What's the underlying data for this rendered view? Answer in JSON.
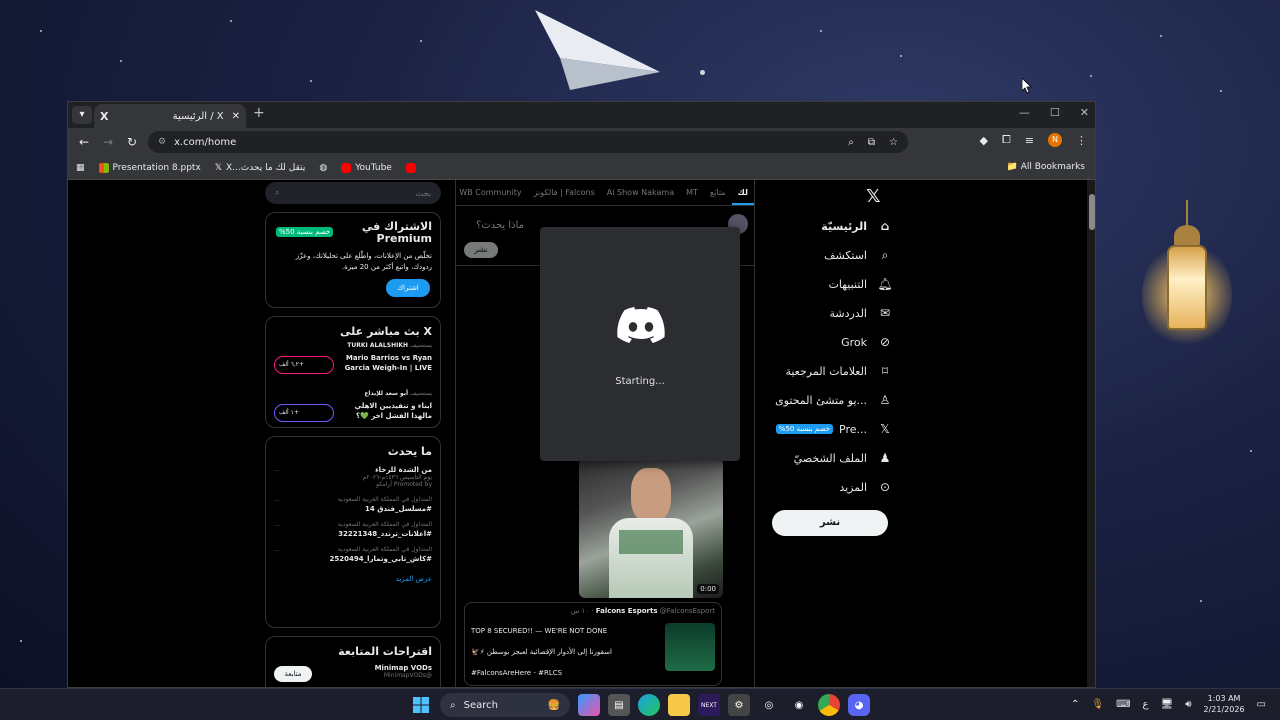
{
  "browser": {
    "tab_title": "الرئيسية / X",
    "tab_logo": "X",
    "url": "x.com/home",
    "bookmarks": [
      {
        "label": "Presentation 8.pptx",
        "icon": "windows-icon",
        "color": "#f25022"
      },
      {
        "label": "X...يتقل لك ما يحدث",
        "icon": "x-icon",
        "color": "#ffffff"
      },
      {
        "label": "",
        "icon": "globe-icon",
        "color": "#cccccc"
      },
      {
        "label": "YouTube",
        "icon": "youtube-icon",
        "color": "#ff0000"
      },
      {
        "label": "",
        "icon": "youtube-icon",
        "color": "#ff0000"
      }
    ],
    "all_bookmarks": "All Bookmarks",
    "profile_initial": "N"
  },
  "nav": {
    "brand": "𝕏",
    "items": [
      {
        "label": "الرئيسيّة",
        "icon": "home-icon"
      },
      {
        "label": "استكشف",
        "icon": "search-icon"
      },
      {
        "label": "التنبيهات",
        "icon": "bell-icon"
      },
      {
        "label": "الدردشة",
        "icon": "mail-icon"
      },
      {
        "label": "Grok",
        "icon": "grok-icon"
      },
      {
        "label": "العلامات المرجعية",
        "icon": "bookmark-icon"
      },
      {
        "label": "...يو متشئ المحتوى",
        "icon": "creator-icon"
      },
      {
        "label": "...Pre",
        "icon": "x-icon",
        "badge": "خصم بنسبة 50%"
      },
      {
        "label": "الملف الشخصيّ",
        "icon": "person-icon"
      },
      {
        "label": "المزيد",
        "icon": "more-icon"
      }
    ],
    "post_button": "نشر"
  },
  "timeline": {
    "tabs": [
      "لك",
      "متابَع",
      "MT",
      "Ai Show Nakama",
      "فالكونز | Falcons",
      "WB Community"
    ],
    "compose_placeholder": "ماذا يحدث؟",
    "compose_button": "نشر",
    "video_duration": "0:00",
    "quote": {
      "author": "Falcons Esports",
      "handle": "@FalconsEsport",
      "time": "١٠ س",
      "line1": "TOP 8 SECURED!! — WE'RE NOT DONE",
      "line2": "اسقورنا إلى الأدوار الإقصائية لعبجز بوسطن ⚡🦅",
      "line3": "#FalconsAreHere - #RLCS"
    }
  },
  "sidebar": {
    "search_placeholder": "بحث",
    "premium": {
      "title": "الاشتراك في Premium",
      "discount": "خصم بنسبة 50%",
      "body": "تخلّص من الإعلانات، واطّلع على تحليلاتك، وعزّز ردودك، واتبع أكثر من 20 ميزة.",
      "button": "اشتراك"
    },
    "live": {
      "title": "X بث مباشر على",
      "rows": [
        {
          "host": "TURKI ALALSHIKH",
          "host_prefix": "يستضيف",
          "title": "Mario Barrios vs Ryan Garcia Weigh-In | LIVE",
          "listeners": "٦,٢ ألف+",
          "accent": "pink"
        },
        {
          "host": "أبو سعد للإبداع",
          "host_prefix": "يستضيف",
          "title": "ابناء و تنفيذيين الاهلي مالهذا الفشل اخر 💚؟",
          "listeners": "١ ألف+",
          "accent": "purple"
        }
      ]
    },
    "happening": {
      "title": "ما يحدث",
      "items": [
        {
          "name": "من الشدة للرخاء",
          "meta": "يوم التأسيس ١٤٣٦م-٢٠٢٦م",
          "extra": "Promoted by أرامكو"
        },
        {
          "name": "#مسلسل_فندق 14",
          "meta": "المتداول في المملكة العربية السعودية",
          "extra": ""
        },
        {
          "name": "#اعلانات_ترندد_32221348",
          "meta": "المتداول في المملكة العربية السعودية",
          "extra": ""
        },
        {
          "name": "#كاش_تابي_وتمارا_2520494",
          "meta": "المتداول في المملكة العربية السعودية",
          "extra": ""
        }
      ],
      "show_more": "عرض المزيد"
    },
    "follow": {
      "title": "اقتراحات المتابعة",
      "name": "Minimap VODs",
      "handle": "@MinimapVODs",
      "button": "متابعة"
    }
  },
  "discord": {
    "status": "Starting..."
  },
  "taskbar": {
    "search": "Search",
    "lang": "ع",
    "time": "1:03 AM",
    "date": "2/21/2026"
  }
}
